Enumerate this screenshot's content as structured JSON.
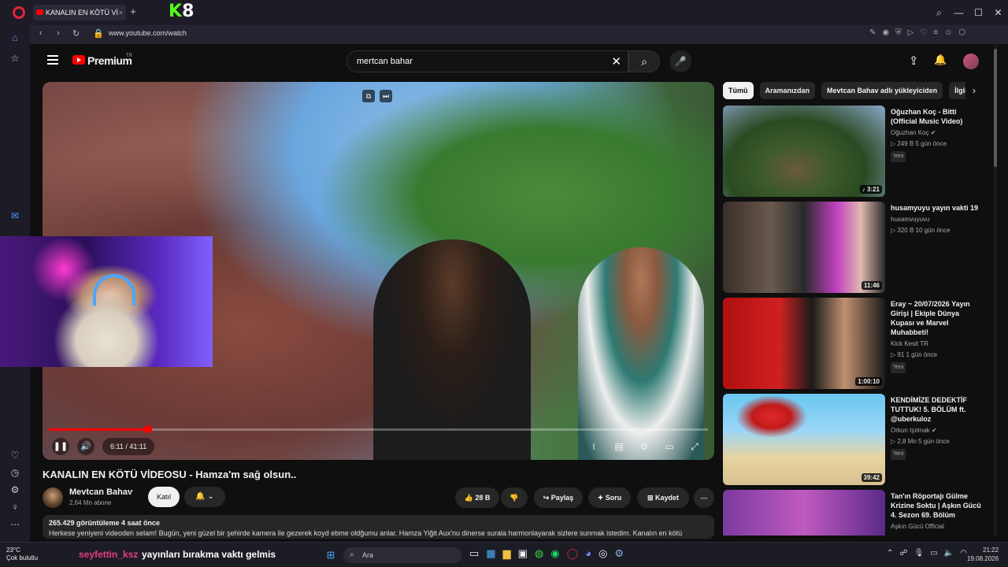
{
  "browser": {
    "tab_title": "KANALIN EN KÖTÜ Vİ",
    "tab_close": "×",
    "new_tab": "+",
    "k8_k": "K",
    "k8_num": "8",
    "url": "www.youtube.com/watch",
    "window_controls": {
      "search": "⌕",
      "minimize": "—",
      "maximize": "☐",
      "close": "✕"
    }
  },
  "youtube": {
    "brand": "Premium",
    "region": "TR",
    "search_value": "mertcan bahar",
    "search_clear": "✕",
    "search_icon": "⌕",
    "mic_icon": "🎤",
    "create_icon": "⇪",
    "bell_icon": "🔔"
  },
  "player": {
    "time": "6:11 / 41:11",
    "progress_fraction": 0.15,
    "play_icon": "❚❚",
    "volume_icon": "🔊"
  },
  "video": {
    "title": "KANALIN EN KÖTÜ VİDEOSU - Hamza'm sağ olsun..",
    "channel": "Mevtcan Bahav",
    "verified": "✔",
    "subscribers": "2,64 Mn abone",
    "join_label": "Katıl",
    "bell_label": "🔔 ⌄",
    "likes": "👍 28 B",
    "dislike": "👎",
    "share": "↪ Paylaş",
    "ask": "✦ Soru",
    "save": "⊞ Kaydet",
    "more": "⋯",
    "stats": "265.429 görüntüleme  4 saat önce",
    "description": "Herkese yeniyeni videoden selam! Bugün, yeni güzel bir şehirde kamera ile gezerek koyd ebme oldğumu anlar. Hamza Yiğit Aux'nu dinerse surala harmonlayarak sizlere sunmak istedim. Kanalın en kötü"
  },
  "chips": [
    {
      "label": "Tümü",
      "active": true
    },
    {
      "label": "Aramanızdan",
      "active": false
    },
    {
      "label": "Mevtcan Bahav adlı yükleyiciden",
      "active": false
    },
    {
      "label": "İlgili",
      "active": false
    }
  ],
  "chips_next": "›",
  "recommendations": [
    {
      "title": "Oğuzhan Koç - Bitti (Official Music Video)",
      "channel": "Oğuzhan Koç ✔",
      "meta": "▷ 249 B  5 gün önce",
      "badge": "Yeni",
      "duration": "♪ 3:21"
    },
    {
      "title": "husamyuyu yayın vakti 19",
      "channel": "husamvuyuvu",
      "meta": "▷ 320 B  10 gün önce",
      "badge": "",
      "duration": "11:46"
    },
    {
      "title": "Eray ~ 20/07/2026 Yayın Girişi | Ekiple Dünya Kupası ve Marvel Muhabbeti!",
      "channel": "Kick Kesit TR",
      "meta": "▷ 91  1 gün önce",
      "badge": "Yeni",
      "duration": "1:00:10"
    },
    {
      "title": "KENDİMİZE DEDEKTİF TUTTUK! 5. BÖLÜM ft. @uberkuloz",
      "channel": "Orkun Işıtmak ✔",
      "meta": "▷ 2,8 Mn  5 gün önce",
      "badge": "Yeni",
      "duration": "39:42"
    },
    {
      "title": "Tan'ın Röportajı Gülme Krizine Soktu | Aşkın Gücü 4. Sezon 69. Bölüm",
      "channel": "Aşkın Gücü Official",
      "meta": "",
      "badge": "",
      "duration": ""
    }
  ],
  "taskbar": {
    "temp": "23°C",
    "weather": "Çok bulutlu",
    "chat_user": "seyfettin_ksz",
    "chat_msg": "yayınları bırakma vaktı gelmis",
    "search": "Ara",
    "time": "21:22",
    "date": "19.08.2026"
  }
}
